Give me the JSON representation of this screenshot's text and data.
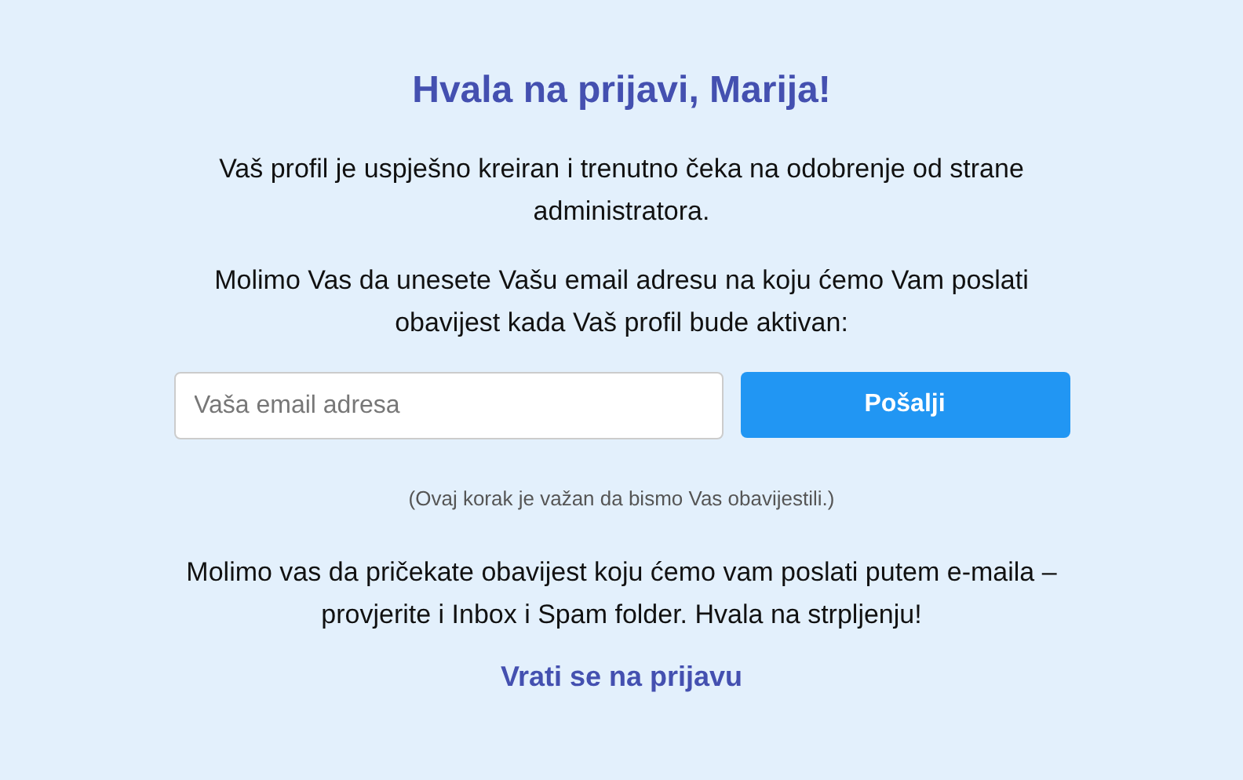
{
  "heading": "Hvala na prijavi, Marija!",
  "message": "Vaš profil je uspješno kreiran i trenutno čeka na odobrenje od strane administratora.",
  "prompt": "Molimo Vas da unesete Vašu email adresu na koju ćemo Vam poslati obavijest kada Vaš profil bude aktivan:",
  "email_field": {
    "placeholder": "Vaša email adresa"
  },
  "submit_button": "Pošalji",
  "note": "(Ovaj korak je važan da bismo Vas obavijestili.)",
  "info": "Molimo vas da pričekate obavijest koju ćemo vam poslati putem e-maila – provjerite i Inbox i Spam folder. Hvala na strpljenju!",
  "back_link": "Vrati se na prijavu"
}
